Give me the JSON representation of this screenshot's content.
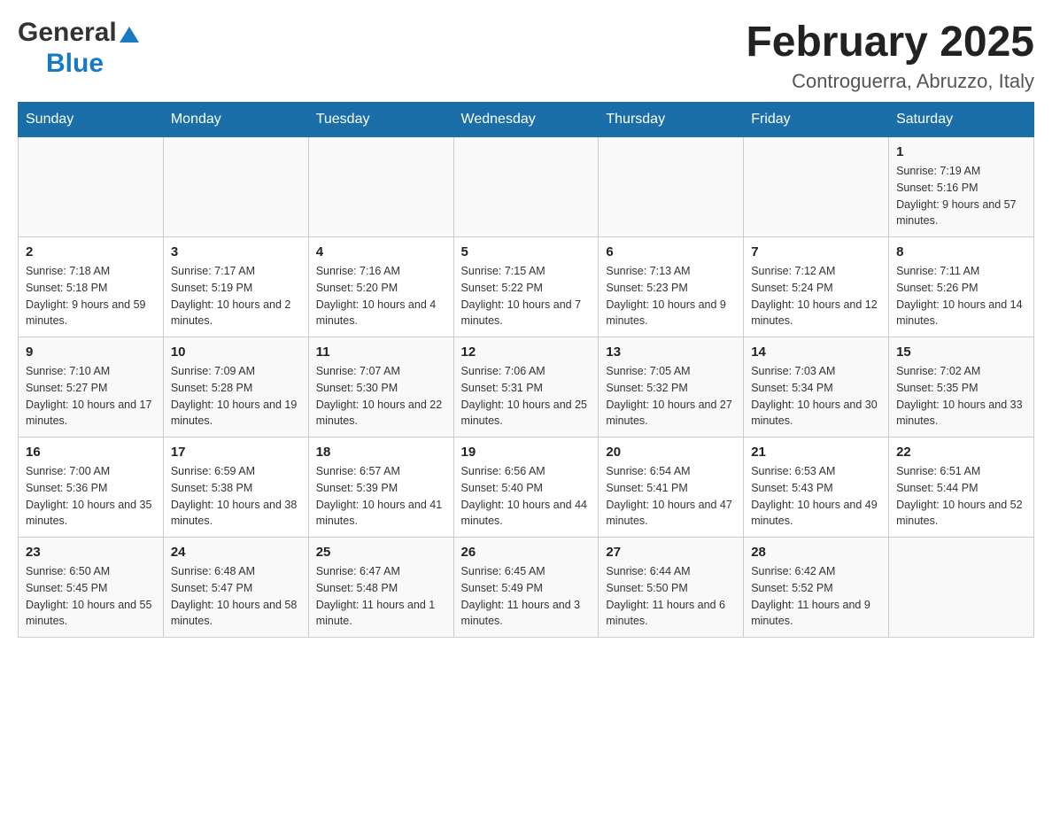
{
  "header": {
    "logo_general": "General",
    "logo_blue": "Blue",
    "title": "February 2025",
    "location": "Controguerra, Abruzzo, Italy"
  },
  "days_of_week": [
    "Sunday",
    "Monday",
    "Tuesday",
    "Wednesday",
    "Thursday",
    "Friday",
    "Saturday"
  ],
  "weeks": [
    [
      {
        "day": "",
        "sunrise": "",
        "sunset": "",
        "daylight": ""
      },
      {
        "day": "",
        "sunrise": "",
        "sunset": "",
        "daylight": ""
      },
      {
        "day": "",
        "sunrise": "",
        "sunset": "",
        "daylight": ""
      },
      {
        "day": "",
        "sunrise": "",
        "sunset": "",
        "daylight": ""
      },
      {
        "day": "",
        "sunrise": "",
        "sunset": "",
        "daylight": ""
      },
      {
        "day": "",
        "sunrise": "",
        "sunset": "",
        "daylight": ""
      },
      {
        "day": "1",
        "sunrise": "Sunrise: 7:19 AM",
        "sunset": "Sunset: 5:16 PM",
        "daylight": "Daylight: 9 hours and 57 minutes."
      }
    ],
    [
      {
        "day": "2",
        "sunrise": "Sunrise: 7:18 AM",
        "sunset": "Sunset: 5:18 PM",
        "daylight": "Daylight: 9 hours and 59 minutes."
      },
      {
        "day": "3",
        "sunrise": "Sunrise: 7:17 AM",
        "sunset": "Sunset: 5:19 PM",
        "daylight": "Daylight: 10 hours and 2 minutes."
      },
      {
        "day": "4",
        "sunrise": "Sunrise: 7:16 AM",
        "sunset": "Sunset: 5:20 PM",
        "daylight": "Daylight: 10 hours and 4 minutes."
      },
      {
        "day": "5",
        "sunrise": "Sunrise: 7:15 AM",
        "sunset": "Sunset: 5:22 PM",
        "daylight": "Daylight: 10 hours and 7 minutes."
      },
      {
        "day": "6",
        "sunrise": "Sunrise: 7:13 AM",
        "sunset": "Sunset: 5:23 PM",
        "daylight": "Daylight: 10 hours and 9 minutes."
      },
      {
        "day": "7",
        "sunrise": "Sunrise: 7:12 AM",
        "sunset": "Sunset: 5:24 PM",
        "daylight": "Daylight: 10 hours and 12 minutes."
      },
      {
        "day": "8",
        "sunrise": "Sunrise: 7:11 AM",
        "sunset": "Sunset: 5:26 PM",
        "daylight": "Daylight: 10 hours and 14 minutes."
      }
    ],
    [
      {
        "day": "9",
        "sunrise": "Sunrise: 7:10 AM",
        "sunset": "Sunset: 5:27 PM",
        "daylight": "Daylight: 10 hours and 17 minutes."
      },
      {
        "day": "10",
        "sunrise": "Sunrise: 7:09 AM",
        "sunset": "Sunset: 5:28 PM",
        "daylight": "Daylight: 10 hours and 19 minutes."
      },
      {
        "day": "11",
        "sunrise": "Sunrise: 7:07 AM",
        "sunset": "Sunset: 5:30 PM",
        "daylight": "Daylight: 10 hours and 22 minutes."
      },
      {
        "day": "12",
        "sunrise": "Sunrise: 7:06 AM",
        "sunset": "Sunset: 5:31 PM",
        "daylight": "Daylight: 10 hours and 25 minutes."
      },
      {
        "day": "13",
        "sunrise": "Sunrise: 7:05 AM",
        "sunset": "Sunset: 5:32 PM",
        "daylight": "Daylight: 10 hours and 27 minutes."
      },
      {
        "day": "14",
        "sunrise": "Sunrise: 7:03 AM",
        "sunset": "Sunset: 5:34 PM",
        "daylight": "Daylight: 10 hours and 30 minutes."
      },
      {
        "day": "15",
        "sunrise": "Sunrise: 7:02 AM",
        "sunset": "Sunset: 5:35 PM",
        "daylight": "Daylight: 10 hours and 33 minutes."
      }
    ],
    [
      {
        "day": "16",
        "sunrise": "Sunrise: 7:00 AM",
        "sunset": "Sunset: 5:36 PM",
        "daylight": "Daylight: 10 hours and 35 minutes."
      },
      {
        "day": "17",
        "sunrise": "Sunrise: 6:59 AM",
        "sunset": "Sunset: 5:38 PM",
        "daylight": "Daylight: 10 hours and 38 minutes."
      },
      {
        "day": "18",
        "sunrise": "Sunrise: 6:57 AM",
        "sunset": "Sunset: 5:39 PM",
        "daylight": "Daylight: 10 hours and 41 minutes."
      },
      {
        "day": "19",
        "sunrise": "Sunrise: 6:56 AM",
        "sunset": "Sunset: 5:40 PM",
        "daylight": "Daylight: 10 hours and 44 minutes."
      },
      {
        "day": "20",
        "sunrise": "Sunrise: 6:54 AM",
        "sunset": "Sunset: 5:41 PM",
        "daylight": "Daylight: 10 hours and 47 minutes."
      },
      {
        "day": "21",
        "sunrise": "Sunrise: 6:53 AM",
        "sunset": "Sunset: 5:43 PM",
        "daylight": "Daylight: 10 hours and 49 minutes."
      },
      {
        "day": "22",
        "sunrise": "Sunrise: 6:51 AM",
        "sunset": "Sunset: 5:44 PM",
        "daylight": "Daylight: 10 hours and 52 minutes."
      }
    ],
    [
      {
        "day": "23",
        "sunrise": "Sunrise: 6:50 AM",
        "sunset": "Sunset: 5:45 PM",
        "daylight": "Daylight: 10 hours and 55 minutes."
      },
      {
        "day": "24",
        "sunrise": "Sunrise: 6:48 AM",
        "sunset": "Sunset: 5:47 PM",
        "daylight": "Daylight: 10 hours and 58 minutes."
      },
      {
        "day": "25",
        "sunrise": "Sunrise: 6:47 AM",
        "sunset": "Sunset: 5:48 PM",
        "daylight": "Daylight: 11 hours and 1 minute."
      },
      {
        "day": "26",
        "sunrise": "Sunrise: 6:45 AM",
        "sunset": "Sunset: 5:49 PM",
        "daylight": "Daylight: 11 hours and 3 minutes."
      },
      {
        "day": "27",
        "sunrise": "Sunrise: 6:44 AM",
        "sunset": "Sunset: 5:50 PM",
        "daylight": "Daylight: 11 hours and 6 minutes."
      },
      {
        "day": "28",
        "sunrise": "Sunrise: 6:42 AM",
        "sunset": "Sunset: 5:52 PM",
        "daylight": "Daylight: 11 hours and 9 minutes."
      },
      {
        "day": "",
        "sunrise": "",
        "sunset": "",
        "daylight": ""
      }
    ]
  ]
}
